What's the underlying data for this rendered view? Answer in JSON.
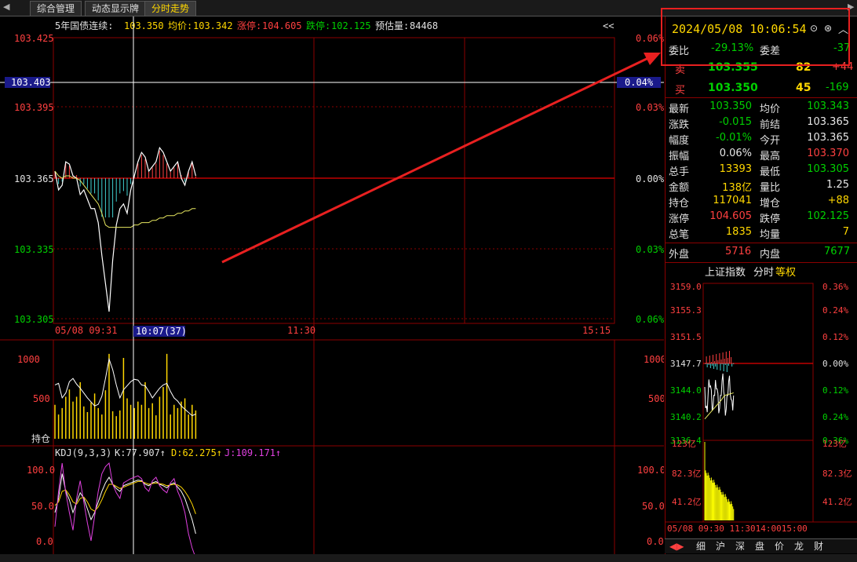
{
  "tabs": {
    "items": [
      "综合管理",
      "动态显示牌",
      "分时走势"
    ],
    "active": 2
  },
  "chart": {
    "title": "5年国债连续:",
    "last_label": "103.350",
    "avg_label": "均价:",
    "avg_value": "103.342",
    "limit_up_label": "涨停:",
    "limit_up_value": "104.605",
    "limit_down_label": "跌停:",
    "limit_down_value": "102.125",
    "estimate_label": "预估量:",
    "estimate_value": "84468",
    "collapse_label": "<<",
    "price_ticks": [
      "103.425",
      "103.395",
      "103.365",
      "103.335",
      "103.305"
    ],
    "pct_ticks": [
      "0.06%",
      "0.03%",
      "0.00%",
      "0.03%",
      "0.06%"
    ],
    "cursor_price": "103.403",
    "cursor_pct": "0.04%",
    "time_ticks": [
      "05/08  09:31",
      "11:30",
      "15:15"
    ],
    "cursor_time": "10:07(37)",
    "vol_ticks": [
      "1000",
      "500"
    ],
    "vol_label": "持仓",
    "kdj_title": "KDJ(9,3,3)",
    "kdj_k": "K:77.907↑",
    "kdj_d": "D:62.275↑",
    "kdj_j": "J:109.171↑",
    "kdj_ticks": [
      "100.0",
      "50.0",
      "0.0"
    ],
    "price_series": [
      103.368,
      103.36,
      103.362,
      103.372,
      103.371,
      103.366,
      103.365,
      103.358,
      103.36,
      103.356,
      103.352,
      103.352,
      103.346,
      103.332,
      103.32,
      103.308,
      103.33,
      103.345,
      103.352,
      103.354,
      103.35,
      103.36,
      103.366,
      103.372,
      103.376,
      103.374,
      103.368,
      103.37,
      103.372,
      103.378,
      103.376,
      103.372,
      103.368,
      103.37,
      103.372,
      103.365,
      103.362,
      103.368,
      103.372,
      103.366
    ],
    "avg_series": [
      103.368,
      103.366,
      103.365,
      103.366,
      103.366,
      103.365,
      103.365,
      103.364,
      103.362,
      103.36,
      103.358,
      103.356,
      103.354,
      103.35,
      103.345,
      103.344,
      103.344,
      103.344,
      103.344,
      103.344,
      103.344,
      103.344,
      103.345,
      103.345,
      103.346,
      103.346,
      103.346,
      103.347,
      103.347,
      103.348,
      103.348,
      103.349,
      103.349,
      103.349,
      103.35,
      103.35,
      103.351,
      103.351,
      103.352,
      103.352
    ],
    "volume_series": [
      420,
      300,
      380,
      520,
      610,
      460,
      520,
      700,
      400,
      330,
      450,
      560,
      380,
      300,
      600,
      1050,
      340,
      280,
      350,
      1000,
      500,
      420,
      380,
      460,
      420,
      700,
      380,
      440,
      290,
      520,
      640,
      1050,
      300,
      420,
      380,
      460,
      500,
      300,
      420,
      350
    ],
    "oi_series": [
      860,
      880,
      700,
      760,
      900,
      940,
      870,
      820,
      760,
      700,
      650,
      600,
      620,
      720,
      940,
      1180,
      1050,
      860,
      700,
      800,
      850,
      900,
      930,
      920,
      860,
      850,
      780,
      700,
      760,
      820,
      860,
      880,
      780,
      700,
      660,
      600,
      560,
      520,
      480,
      500
    ],
    "kdj_k_series": [
      40,
      60,
      95,
      70,
      58,
      40,
      55,
      68,
      60,
      45,
      30,
      40,
      55,
      70,
      82,
      90,
      80,
      74,
      70,
      78,
      80,
      82,
      84,
      86,
      85,
      80,
      78,
      82,
      84,
      80,
      78,
      75,
      80,
      82,
      76,
      70,
      60,
      45,
      30,
      10
    ],
    "kdj_d_series": [
      50,
      55,
      70,
      72,
      65,
      55,
      52,
      60,
      62,
      55,
      45,
      42,
      48,
      58,
      70,
      80,
      80,
      77,
      74,
      76,
      78,
      80,
      82,
      84,
      84,
      82,
      80,
      81,
      82,
      81,
      80,
      78,
      79,
      80,
      79,
      76,
      70,
      62,
      52,
      38
    ],
    "kdj_j_series": [
      20,
      70,
      110,
      68,
      40,
      15,
      60,
      85,
      55,
      25,
      0,
      35,
      70,
      95,
      105,
      110,
      80,
      68,
      60,
      82,
      85,
      88,
      90,
      92,
      88,
      75,
      70,
      85,
      90,
      78,
      72,
      68,
      82,
      88,
      70,
      58,
      40,
      10,
      -10,
      -40
    ]
  },
  "side": {
    "datetime": "2024/05/08  10:06:54",
    "ratio_label": "委比",
    "ratio_value": "-29.13%",
    "diff_label": "委差",
    "diff_value": "-37",
    "sell_label": "卖",
    "sell_price": "103.355",
    "sell_qty": "82",
    "sell_chg": "+44",
    "buy_label": "买",
    "buy_price": "103.350",
    "buy_qty": "45",
    "buy_chg": "-169",
    "stats": [
      {
        "l1": "最新",
        "v1": "103.350",
        "c1": "green",
        "l2": "均价",
        "v2": "103.343",
        "c2": "green"
      },
      {
        "l1": "涨跌",
        "v1": "-0.015",
        "c1": "green",
        "l2": "前结",
        "v2": "103.365",
        "c2": "white"
      },
      {
        "l1": "幅度",
        "v1": "-0.01%",
        "c1": "green",
        "l2": "今开",
        "v2": "103.365",
        "c2": "white"
      },
      {
        "l1": "振幅",
        "v1": "0.06%",
        "c1": "white",
        "l2": "最高",
        "v2": "103.370",
        "c2": "red"
      },
      {
        "l1": "总手",
        "v1": "13393",
        "c1": "yellow",
        "l2": "最低",
        "v2": "103.305",
        "c2": "green"
      },
      {
        "l1": "金额",
        "v1": "138亿",
        "c1": "yellow",
        "l2": "量比",
        "v2": "1.25",
        "c2": "white"
      },
      {
        "l1": "持仓",
        "v1": "117041",
        "c1": "yellow",
        "l2": "增仓",
        "v2": "+88",
        "c2": "yellow"
      },
      {
        "l1": "涨停",
        "v1": "104.605",
        "c1": "red",
        "l2": "跌停",
        "v2": "102.125",
        "c2": "green"
      },
      {
        "l1": "总笔",
        "v1": "1835",
        "c1": "yellow",
        "l2": "均量",
        "v2": "7",
        "c2": "yellow"
      }
    ],
    "outer_label": "外盘",
    "outer_value": "5716",
    "inner_label": "内盘",
    "inner_value": "7677",
    "mini_title": "上证指数",
    "mini_tab1": "分时",
    "mini_tab2": "等权",
    "mini_price_ticks": [
      "3159.0",
      "3155.3",
      "3151.5",
      "3147.7",
      "3144.0",
      "3140.2",
      "3136.4"
    ],
    "mini_pct_ticks": [
      "0.36%",
      "0.24%",
      "0.12%",
      "0.00%",
      "0.12%",
      "0.24%",
      "0.36%"
    ],
    "mini_vol_ticks": [
      "123亿",
      "82.3亿",
      "41.2亿"
    ],
    "mini_time": "05/08  09:30 11:3014:0015:00",
    "bottom_tabs": [
      "细",
      "沪",
      "深",
      "盘",
      "价",
      "龙",
      "财"
    ]
  },
  "colors": {
    "up": "#ff4040",
    "down": "#00d000",
    "highlight": "#e82020"
  }
}
